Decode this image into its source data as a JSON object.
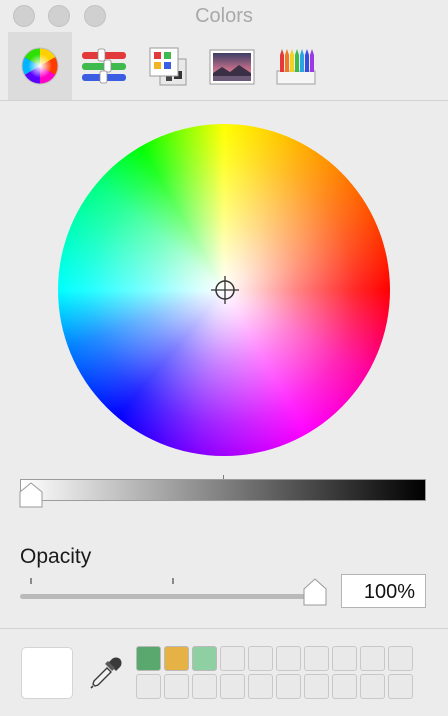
{
  "window": {
    "title": "Colors",
    "buttons": [
      "close",
      "minimize",
      "zoom"
    ]
  },
  "toolbar": {
    "selected_tab": "color-wheel",
    "tabs": [
      {
        "id": "color-wheel",
        "icon": "color-wheel-icon"
      },
      {
        "id": "color-sliders",
        "icon": "color-sliders-icon"
      },
      {
        "id": "color-palettes",
        "icon": "color-palettes-icon"
      },
      {
        "id": "image-palettes",
        "icon": "image-palettes-icon"
      },
      {
        "id": "pencils",
        "icon": "pencils-icon"
      }
    ]
  },
  "brightness": {
    "value_percent": 100,
    "track_colors": [
      "#ffffff",
      "#000000"
    ]
  },
  "opacity": {
    "label": "Opacity",
    "value": "100%",
    "value_percent": 100
  },
  "current_color": "#ffffff",
  "saved_swatches": [
    "#5aa86d",
    "#e6b145",
    "#8fd0a3"
  ],
  "swatch_grid": {
    "rows": 2,
    "columns": 10
  }
}
